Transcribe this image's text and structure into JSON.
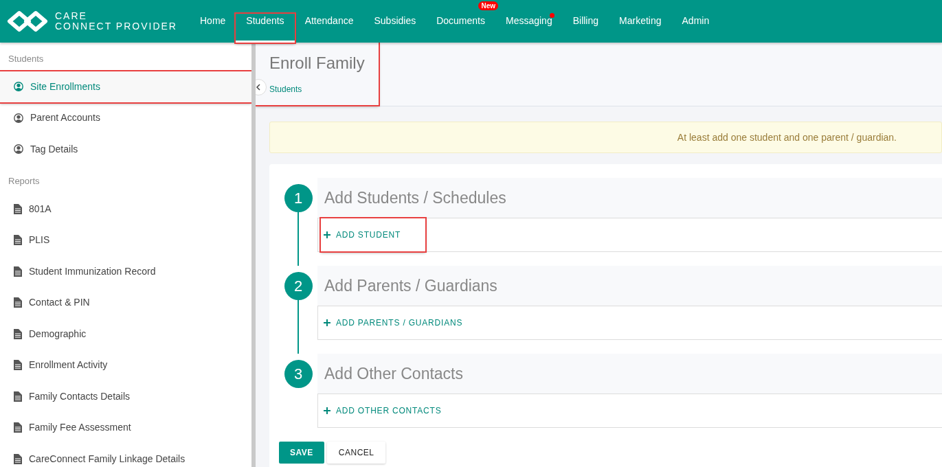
{
  "brand": {
    "line_1": "CARE",
    "line_2": "CONNECT PROVIDER"
  },
  "nav": [
    {
      "label": "Home",
      "selected": false,
      "highlighted": false
    },
    {
      "label": "Students",
      "selected": true,
      "highlighted": true
    },
    {
      "label": "Attendance",
      "selected": false,
      "highlighted": false
    },
    {
      "label": "Subsidies",
      "selected": false,
      "highlighted": false
    },
    {
      "label": "Documents",
      "selected": false,
      "highlighted": false,
      "badge": "New"
    },
    {
      "label": "Messaging",
      "selected": false,
      "highlighted": false,
      "notification_dot": true
    },
    {
      "label": "Billing",
      "selected": false,
      "highlighted": false
    },
    {
      "label": "Marketing",
      "selected": false,
      "highlighted": false
    },
    {
      "label": "Admin",
      "selected": false,
      "highlighted": false
    }
  ],
  "sidebar": {
    "sections": [
      {
        "title": "Students",
        "kind": "accounts",
        "items": [
          {
            "label": "Site Enrollments",
            "selected": true,
            "highlighted": true
          },
          {
            "label": "Parent Accounts",
            "selected": false,
            "highlighted": false
          },
          {
            "label": "Tag Details",
            "selected": false,
            "highlighted": false
          }
        ]
      },
      {
        "title": "Reports",
        "kind": "reports",
        "items": [
          {
            "label": "801A",
            "selected": false,
            "highlighted": false
          },
          {
            "label": "PLIS",
            "selected": false,
            "highlighted": false
          },
          {
            "label": "Student Immunization Record",
            "selected": false,
            "highlighted": false
          },
          {
            "label": "Contact & PIN",
            "selected": false,
            "highlighted": false
          },
          {
            "label": "Demographic",
            "selected": false,
            "highlighted": false
          },
          {
            "label": "Enrollment Activity",
            "selected": false,
            "highlighted": false
          },
          {
            "label": "Family Contacts Details",
            "selected": false,
            "highlighted": false
          },
          {
            "label": "Family Fee Assessment",
            "selected": false,
            "highlighted": false
          },
          {
            "label": "CareConnect Family Linkage Details",
            "selected": false,
            "highlighted": false
          }
        ]
      }
    ]
  },
  "page_header": {
    "title": "Enroll Family",
    "breadcrumb": "Students",
    "highlighted": true
  },
  "alert": "At least add one student and one parent / guardian.",
  "steps": [
    {
      "number": "1",
      "title": "Add Students / Schedules",
      "action": "ADD STUDENT",
      "highlighted": true
    },
    {
      "number": "2",
      "title": "Add Parents / Guardians",
      "action": "ADD PARENTS / GUARDIANS",
      "highlighted": false
    },
    {
      "number": "3",
      "title": "Add Other Contacts",
      "action": "ADD OTHER CONTACTS",
      "highlighted": false
    }
  ],
  "buttons": {
    "save": "SAVE",
    "cancel": "CANCEL"
  }
}
